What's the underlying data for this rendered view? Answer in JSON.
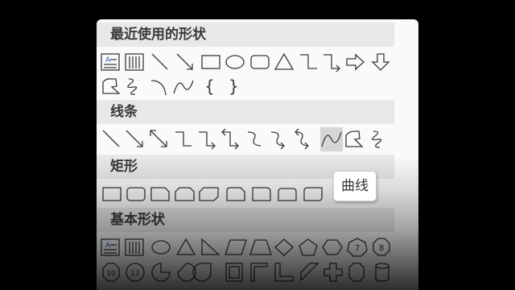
{
  "sections": {
    "recent": {
      "title": "最近使用的形状"
    },
    "lines": {
      "title": "线条"
    },
    "rect": {
      "title": "矩形"
    },
    "basic": {
      "title": "基本形状"
    }
  },
  "tooltip": {
    "text": "曲线"
  },
  "basic_numbered": {
    "oct7": "7",
    "oct8": "8",
    "dec10": "10",
    "dodec12": "12"
  },
  "text_box_glyph": "A"
}
